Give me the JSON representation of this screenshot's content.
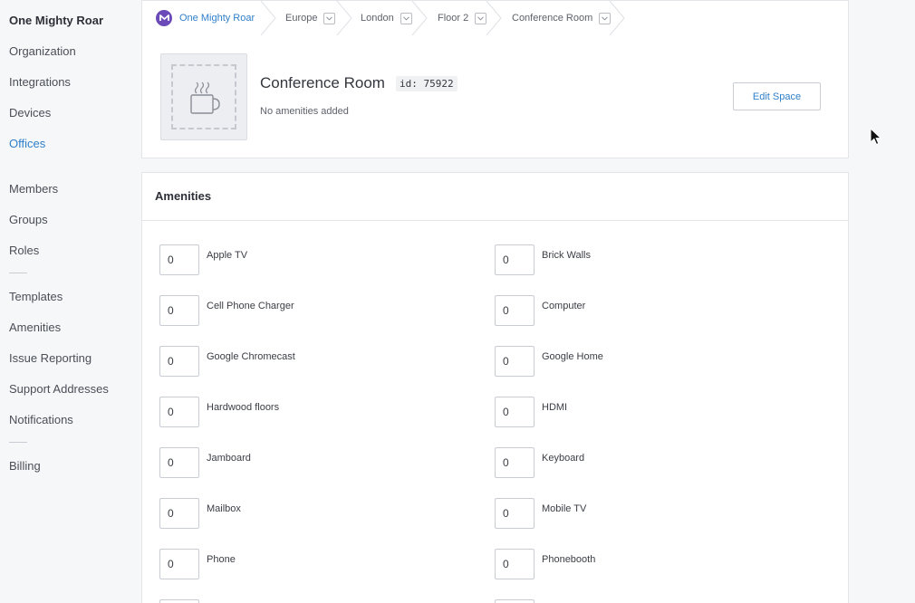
{
  "sidebar": {
    "org_name": "One Mighty Roar",
    "items": [
      {
        "label": "Organization",
        "active": false
      },
      {
        "label": "Integrations",
        "active": false
      },
      {
        "label": "Devices",
        "active": false
      },
      {
        "label": "Offices",
        "active": true
      },
      {
        "label": "Members",
        "active": false
      },
      {
        "label": "Groups",
        "active": false
      },
      {
        "label": "Roles",
        "active": false
      },
      {
        "label": "Templates",
        "active": false
      },
      {
        "label": "Amenities",
        "active": false
      },
      {
        "label": "Issue Reporting",
        "active": false
      },
      {
        "label": "Support Addresses",
        "active": false
      },
      {
        "label": "Notifications",
        "active": false
      },
      {
        "label": "Billing",
        "active": false
      }
    ]
  },
  "breadcrumb": [
    {
      "label": "One Mighty Roar",
      "icon": "m-logo-icon"
    },
    {
      "label": "Europe"
    },
    {
      "label": "London"
    },
    {
      "label": "Floor 2"
    },
    {
      "label": "Conference Room"
    }
  ],
  "space": {
    "title": "Conference Room",
    "id_label": "id: 75922",
    "amenities_summary": "No amenities added",
    "edit_label": "Edit Space",
    "thumbnail_icon": "coffee-cup-icon"
  },
  "amenities": {
    "title": "Amenities",
    "left": [
      {
        "label": "Apple TV",
        "value": "0"
      },
      {
        "label": "Cell Phone Charger",
        "value": "0"
      },
      {
        "label": "Google Chromecast",
        "value": "0"
      },
      {
        "label": "Hardwood floors",
        "value": "0"
      },
      {
        "label": "Jamboard",
        "value": "0"
      },
      {
        "label": "Mailbox",
        "value": "0"
      },
      {
        "label": "Phone",
        "value": "0"
      }
    ],
    "right": [
      {
        "label": "Brick Walls",
        "value": "0"
      },
      {
        "label": "Computer",
        "value": "0"
      },
      {
        "label": "Google Home",
        "value": "0"
      },
      {
        "label": "HDMI",
        "value": "0"
      },
      {
        "label": "Keyboard",
        "value": "0"
      },
      {
        "label": "Mobile TV",
        "value": "0"
      },
      {
        "label": "Phonebooth",
        "value": "0"
      }
    ]
  },
  "colors": {
    "accent": "#2f7fc9",
    "brand": "#6b4bb8"
  }
}
